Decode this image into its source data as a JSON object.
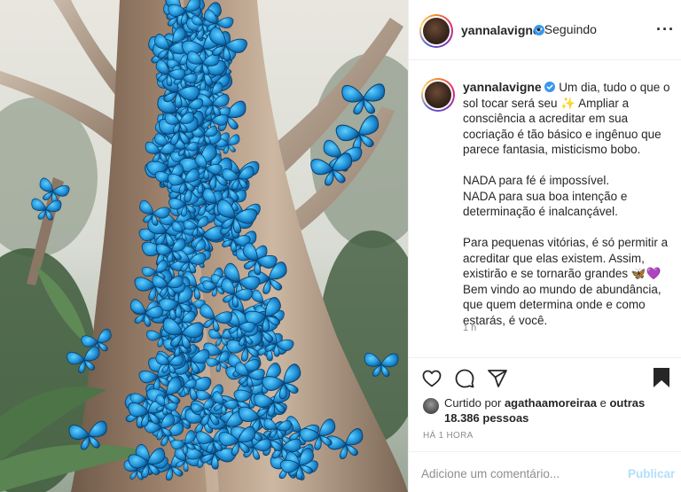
{
  "post": {
    "image_alt": "Árvore coberta de borboletas azuis"
  },
  "header": {
    "username": "yannalavigne",
    "separator": "•",
    "follow_label": "Seguindo",
    "more_icon": "more-horizontal-icon"
  },
  "caption": {
    "username": "yannalavigne",
    "paragraphs": [
      "Um dia, tudo o que o sol tocar será seu ✨ Ampliar a consciência a acreditar em sua cocriação é tão básico e ingênuo que parece fantasia, misticismo bobo.",
      "NADA para fé é impossível.\nNADA para sua boa intenção e determinação é inalcançável.",
      "Para pequenas vitórias, é só permitir a acreditar que elas existem. Assim, existirão e se tornarão grandes 🦋💜 Bem vindo ao mundo de abundância, que quem determina onde e como estarás, é você."
    ],
    "time": "1 h"
  },
  "actions": {
    "icons": [
      "heart-icon",
      "comment-icon",
      "share-icon",
      "bookmark-icon"
    ]
  },
  "likes": {
    "prefix": "Curtido por",
    "user": "agathaamoreiraa",
    "connector": "e",
    "others": "outras 18.386 pessoas"
  },
  "timestamp": "HÁ 1 HORA",
  "comment": {
    "placeholder": "Adicione um comentário...",
    "publish_label": "Publicar"
  },
  "colors": {
    "verified_blue": "#3897f0",
    "publish_disabled": "#b2dffc",
    "muted_text": "#8e8e8e",
    "butterfly_blue": "#2fa0e0"
  }
}
